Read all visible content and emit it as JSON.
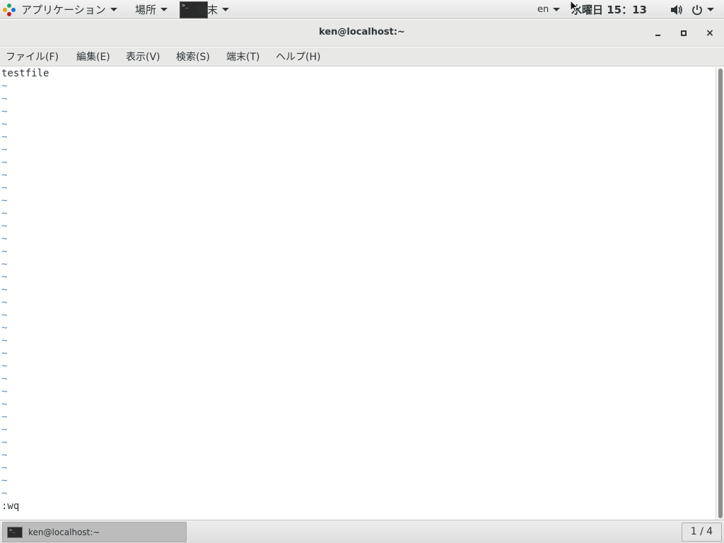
{
  "top_panel": {
    "applications_label": "アプリケーション",
    "places_label": "場所",
    "window_list_label": "端末",
    "term_thumb_text": ">_",
    "language": "en",
    "clock": "水曜日  15：13",
    "icons": [
      "apps-logo-icon",
      "volume-icon",
      "power-icon"
    ]
  },
  "window": {
    "title": "ken@localhost:~",
    "controls": {
      "minimize": "-",
      "maximize": "□",
      "close": "×"
    }
  },
  "menubar": {
    "items": [
      {
        "label": "ファイル(F)"
      },
      {
        "label": "編集(E)"
      },
      {
        "label": "表示(V)"
      },
      {
        "label": "検索(S)"
      },
      {
        "label": "端末(T)"
      },
      {
        "label": "ヘルプ(H)"
      }
    ]
  },
  "terminal": {
    "first_line": "testfile",
    "empty_line_marker": "~",
    "empty_line_count": 33,
    "command_line": ":wq"
  },
  "taskbar": {
    "task_label": "ken@localhost:~",
    "workspace": "1 / 4"
  },
  "colors": {
    "tilde": "#5f87af",
    "text": "#2e3436",
    "panel_bg": "#e8e8e7"
  }
}
